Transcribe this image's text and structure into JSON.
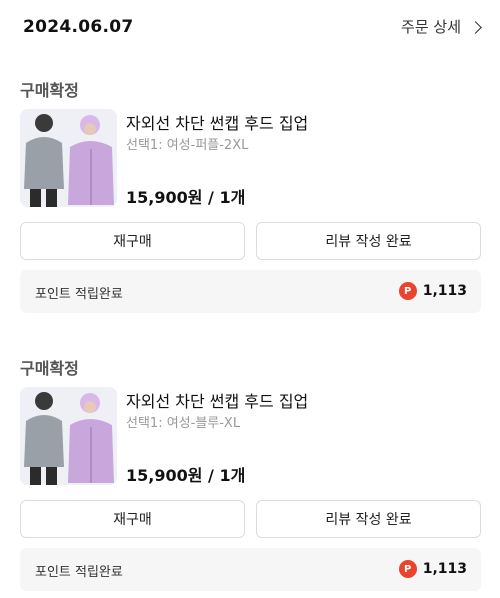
{
  "order": {
    "date": "2024.06.07",
    "detail_label": "주문 상세"
  },
  "items": [
    {
      "status": "구매확정",
      "product_name": "자외선 차단 썬캡 후드 집업",
      "option": "선택1: 여성-퍼플-2XL",
      "price": "15,900원 / 1개",
      "rebuy_label": "재구매",
      "review_label": "리뷰 작성 완료",
      "point_label": "포인트 적립완료",
      "point_icon": "P",
      "point_value": "1,113"
    },
    {
      "status": "구매확정",
      "product_name": "자외선 차단 썬캡 후드 집업",
      "option": "선택1: 여성-블루-XL",
      "price": "15,900원 / 1개",
      "rebuy_label": "재구매",
      "review_label": "리뷰 작성 완료",
      "point_label": "포인트 적립완료",
      "point_icon": "P",
      "point_value": "1,113"
    }
  ],
  "colors": {
    "point_badge": "#e8452c",
    "panel_bg": "#f6f6f6",
    "jacket_gray": "#9aa0a8",
    "jacket_purple": "#c9a6dc"
  }
}
